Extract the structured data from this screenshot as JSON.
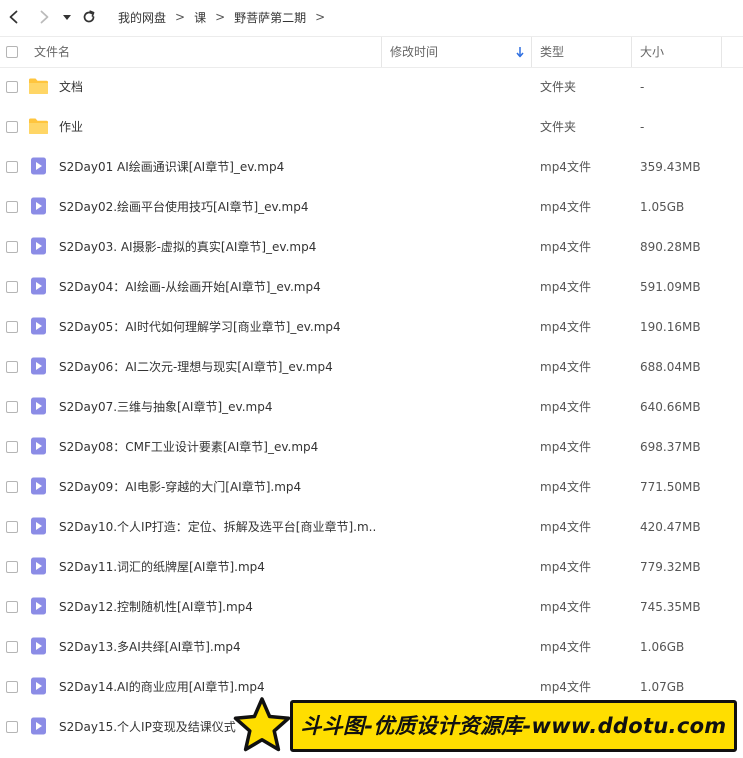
{
  "breadcrumb": {
    "items": [
      "我的网盘",
      "课",
      "野菩萨第二期"
    ],
    "separator": ">"
  },
  "table": {
    "headers": {
      "name": "文件名",
      "modified": "修改时间",
      "type": "类型",
      "size": "大小"
    },
    "sort": {
      "column": "modified",
      "direction": "descending"
    },
    "rows": [
      {
        "icon": "folder-icon",
        "name": "文档",
        "type": "文件夹",
        "size": "-"
      },
      {
        "icon": "folder-icon",
        "name": "作业",
        "type": "文件夹",
        "size": "-"
      },
      {
        "icon": "video-file-icon",
        "name": "S2Day01 AI绘画通识课[AI章节]_ev.mp4",
        "type": "mp4文件",
        "size": "359.43MB"
      },
      {
        "icon": "video-file-icon",
        "name": "S2Day02.绘画平台使用技巧[AI章节]_ev.mp4",
        "type": "mp4文件",
        "size": "1.05GB"
      },
      {
        "icon": "video-file-icon",
        "name": "S2Day03. AI摄影-虚拟的真实[AI章节]_ev.mp4",
        "type": "mp4文件",
        "size": "890.28MB"
      },
      {
        "icon": "video-file-icon",
        "name": "S2Day04：AI绘画-从绘画开始[AI章节]_ev.mp4",
        "type": "mp4文件",
        "size": "591.09MB"
      },
      {
        "icon": "video-file-icon",
        "name": "S2Day05：AI时代如何理解学习[商业章节]_ev.mp4",
        "type": "mp4文件",
        "size": "190.16MB"
      },
      {
        "icon": "video-file-icon",
        "name": "S2Day06：AI二次元-理想与现实[AI章节]_ev.mp4",
        "type": "mp4文件",
        "size": "688.04MB"
      },
      {
        "icon": "video-file-icon",
        "name": "S2Day07.三维与抽象[AI章节]_ev.mp4",
        "type": "mp4文件",
        "size": "640.66MB"
      },
      {
        "icon": "video-file-icon",
        "name": "S2Day08：CMF工业设计要素[AI章节]_ev.mp4",
        "type": "mp4文件",
        "size": "698.37MB"
      },
      {
        "icon": "video-file-icon",
        "name": "S2Day09：AI电影-穿越的大门[AI章节].mp4",
        "type": "mp4文件",
        "size": "771.50MB"
      },
      {
        "icon": "video-file-icon",
        "name": "S2Day10.个人IP打造：定位、拆解及选平台[商业章节].m...",
        "type": "mp4文件",
        "size": "420.47MB"
      },
      {
        "icon": "video-file-icon",
        "name": "S2Day11.词汇的纸牌屋[AI章节].mp4",
        "type": "mp4文件",
        "size": "779.32MB"
      },
      {
        "icon": "video-file-icon",
        "name": "S2Day12.控制随机性[AI章节].mp4",
        "type": "mp4文件",
        "size": "745.35MB"
      },
      {
        "icon": "video-file-icon",
        "name": "S2Day13.多AI共绎[AI章节].mp4",
        "type": "mp4文件",
        "size": "1.06GB"
      },
      {
        "icon": "video-file-icon",
        "name": "S2Day14.AI的商业应用[AI章节].mp4",
        "type": "mp4文件",
        "size": "1.07GB"
      },
      {
        "icon": "video-file-icon",
        "name": "S2Day15.个人IP变现及结课仪式",
        "type": "",
        "size": ""
      }
    ]
  },
  "watermark": {
    "text": "斗斗图-优质设计资源库-www.ddotu.com",
    "icon": "star-icon"
  },
  "colors": {
    "folder": "#ffc53d",
    "video_icon": "#8b8ce6",
    "sort_arrow": "#2f6fe0",
    "watermark_bg": "#ffde00"
  }
}
